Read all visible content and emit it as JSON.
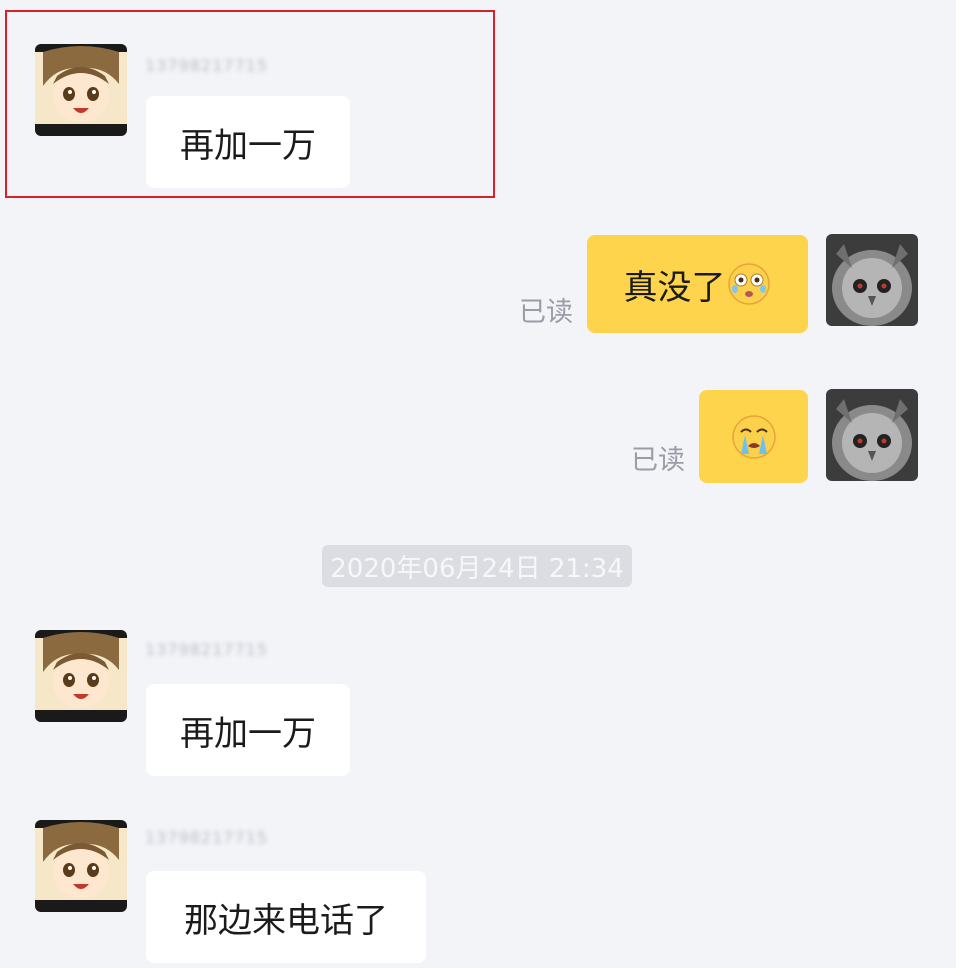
{
  "messages": [
    {
      "sender_blurred": "13798217715",
      "text": "再加一万"
    },
    {
      "text": "真没了",
      "status": "已读",
      "emoji": "crying-face"
    },
    {
      "status": "已读",
      "emoji": "loudly-crying-face"
    },
    {
      "sender_blurred": "13798217715",
      "text": "再加一万"
    },
    {
      "sender_blurred": "13798217715",
      "text": "那边来电话了"
    }
  ],
  "timestamp": "2020年06月24日 21:34",
  "colors": {
    "background": "#f3f4f8",
    "incoming_bubble": "#ffffff",
    "outgoing_bubble": "#fdd44c",
    "highlight_border": "#d8202a"
  }
}
